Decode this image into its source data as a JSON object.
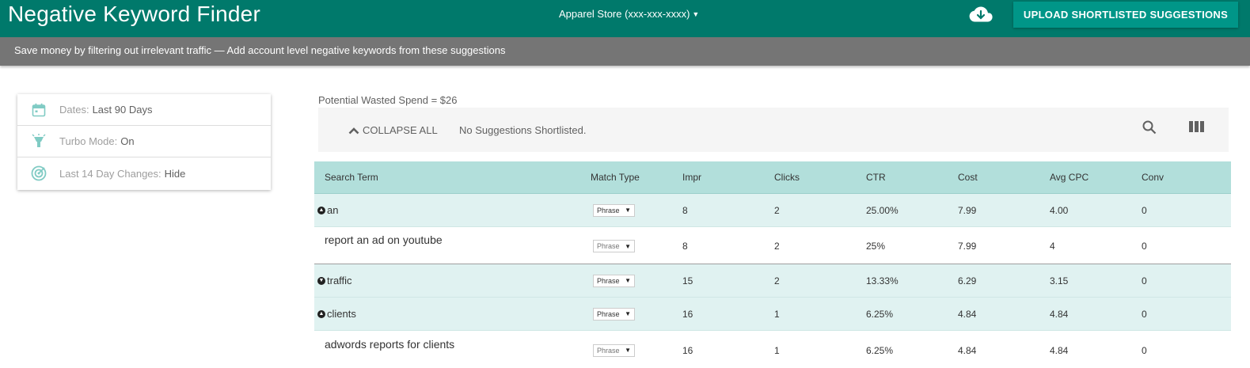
{
  "header": {
    "title": "Negative Keyword Finder",
    "account": "Apparel Store (xxx-xxx-xxxx)",
    "upload_label": "UPLOAD SHORTLISTED SUGGESTIONS"
  },
  "banner": {
    "text": "Save money by filtering out irrelevant traffic — Add account level negative keywords from these suggestions"
  },
  "settings": {
    "dates_key": "Dates:",
    "dates_val": "Last 90 Days",
    "turbo_key": "Turbo Mode:",
    "turbo_val": "On",
    "changes_key": "Last 14 Day Changes:",
    "changes_val": "Hide"
  },
  "summary": {
    "wasted": "Potential Wasted Spend = $26",
    "collapse_label": "COLLAPSE ALL",
    "status": "No Suggestions Shortlisted."
  },
  "table": {
    "headers": [
      "Search Term",
      "Match Type",
      "Impr",
      "Clicks",
      "CTR",
      "Cost",
      "Avg CPC",
      "Conv"
    ],
    "rows": [
      {
        "term": "an",
        "match": "Phrase",
        "impr": "8",
        "clicks": "2",
        "ctr": "25.00%",
        "cost": "7.99",
        "cpc": "4.00",
        "conv": "0"
      },
      {
        "term": "report an ad on youtube",
        "match": "Phrase",
        "impr": "8",
        "clicks": "2",
        "ctr": "25%",
        "cost": "7.99",
        "cpc": "4",
        "conv": "0"
      },
      {
        "term": "traffic",
        "match": "Phrase",
        "impr": "15",
        "clicks": "2",
        "ctr": "13.33%",
        "cost": "6.29",
        "cpc": "3.15",
        "conv": "0"
      },
      {
        "term": "clients",
        "match": "Phrase",
        "impr": "16",
        "clicks": "1",
        "ctr": "6.25%",
        "cost": "4.84",
        "cpc": "4.84",
        "conv": "0"
      },
      {
        "term": "adwords reports for clients",
        "match": "Phrase",
        "impr": "16",
        "clicks": "1",
        "ctr": "6.25%",
        "cost": "4.84",
        "cpc": "4.84",
        "conv": "0"
      }
    ]
  },
  "icons": {
    "cloud": "cloud-download-icon",
    "calendar": "calendar-icon",
    "turbo": "lamp-icon",
    "changes": "radar-icon",
    "collapse": "chevron-up-icon",
    "search": "search-icon",
    "columns": "columns-icon"
  },
  "colors": {
    "header": "#00796b",
    "upload_button": "#009688",
    "banner": "#757575",
    "table_header": "#b2dfdb",
    "group_row": "#e0f2f1",
    "icon_accent": "#80cbc4"
  }
}
